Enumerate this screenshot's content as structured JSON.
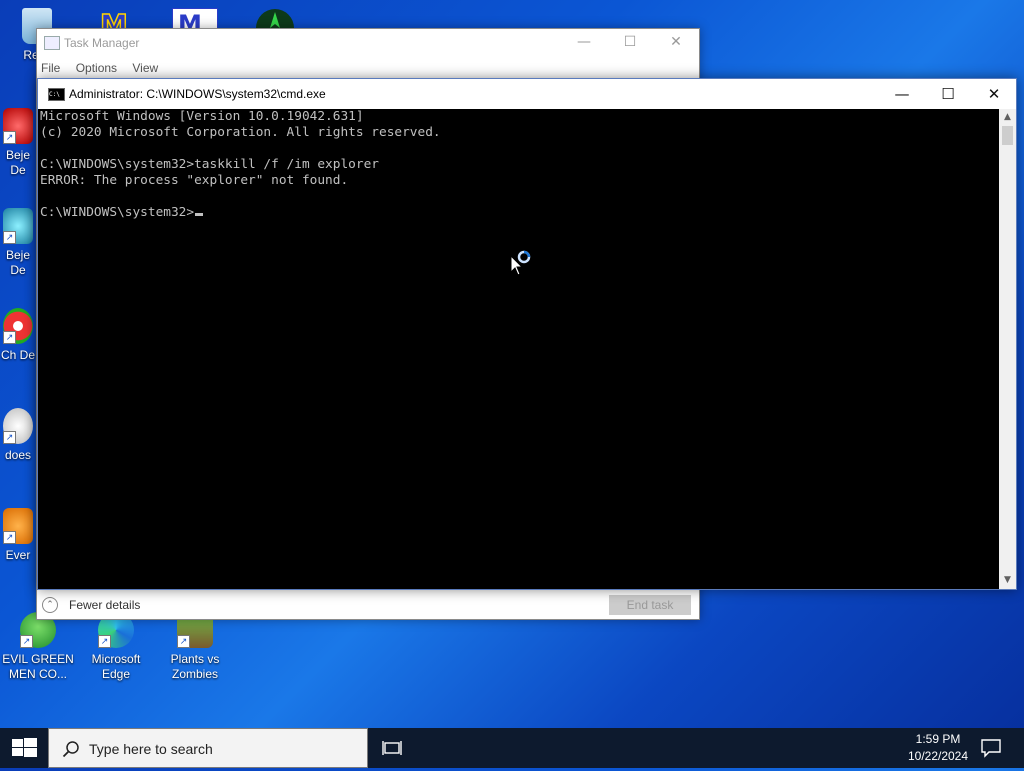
{
  "desktop": {
    "icons": [
      {
        "label": "Recy",
        "icon": "recycle-bin-icon"
      },
      {
        "label": "Beje De",
        "icon": "bejeweled-icon"
      },
      {
        "label": "Beje De",
        "icon": "bejeweled-icon"
      },
      {
        "label": "Ch De",
        "icon": "chrome-icon"
      },
      {
        "label": "does",
        "icon": "shortcut-icon"
      },
      {
        "label": "Ever",
        "icon": "shortcut-icon"
      },
      {
        "label": "EVIL GREEN MEN CO...",
        "icon": "game-icon"
      },
      {
        "label": "Microsoft Edge",
        "icon": "edge-icon"
      },
      {
        "label": "Plants vs Zombies",
        "icon": "plants-vs-zombies-icon"
      }
    ]
  },
  "task_manager": {
    "title": "Task Manager",
    "menu": [
      "File",
      "Options",
      "View"
    ],
    "fewer_details": "Fewer details",
    "end_task": "End task"
  },
  "cmd": {
    "title": "Administrator: C:\\WINDOWS\\system32\\cmd.exe",
    "lines": [
      "Microsoft Windows [Version 10.0.19042.631]",
      "(c) 2020 Microsoft Corporation. All rights reserved.",
      "",
      "C:\\WINDOWS\\system32>taskkill /f /im explorer",
      "ERROR: The process \"explorer\" not found.",
      "",
      "C:\\WINDOWS\\system32>"
    ]
  },
  "window_controls": {
    "minimize": "—",
    "maximize": "☐",
    "close": "✕"
  },
  "taskbar": {
    "search_placeholder": "Type here to search",
    "time": "1:59 PM",
    "date": "10/22/2024"
  },
  "colors": {
    "console_bg": "#000000",
    "console_text": "#c0c0c0",
    "taskbar": "#0d1a2e",
    "desktop_accent": "#0b56d4"
  }
}
